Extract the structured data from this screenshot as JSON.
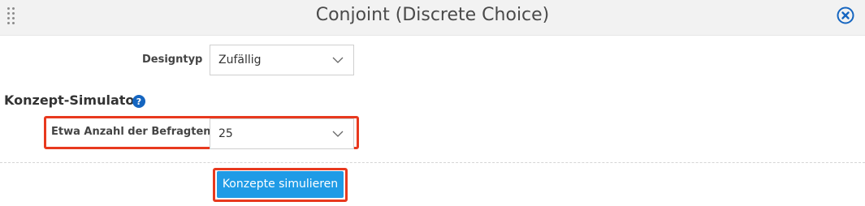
{
  "dialog": {
    "title": "Conjoint (Discrete Choice)"
  },
  "design": {
    "label": "Designtyp",
    "value": "Zufällig"
  },
  "simulator": {
    "title": "Konzept-Simulator",
    "respondents_label": "Etwa Anzahl der Befragten:",
    "respondents_value": "25",
    "simulate_button": "Konzepte simulieren"
  },
  "colors": {
    "accent": "#1f9be6",
    "highlight": "#e8391e",
    "help_icon": "#1565c0",
    "close_icon": "#1565c0"
  },
  "icons": {
    "drag": "drag-handle-icon",
    "close": "close-icon",
    "help": "help-icon",
    "chevron": "chevron-down-icon"
  }
}
